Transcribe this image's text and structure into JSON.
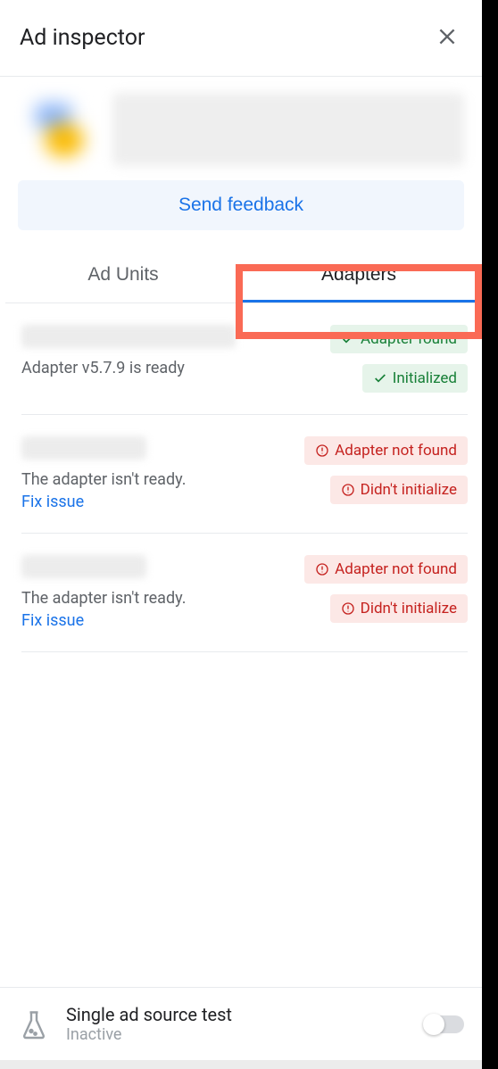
{
  "header": {
    "title": "Ad inspector"
  },
  "feedback_label": "Send feedback",
  "tabs": {
    "ad_units": "Ad Units",
    "adapters": "Adapters"
  },
  "adapters": [
    {
      "status_text": "Adapter v5.7.9 is ready",
      "fix_label": null,
      "badges": [
        {
          "type": "ok",
          "label": "Adapter found"
        },
        {
          "type": "ok",
          "label": "Initialized"
        }
      ]
    },
    {
      "status_text": "The adapter isn't ready.",
      "fix_label": "Fix issue",
      "badges": [
        {
          "type": "err",
          "label": "Adapter not found"
        },
        {
          "type": "err",
          "label": "Didn't initialize"
        }
      ]
    },
    {
      "status_text": "The adapter isn't ready.",
      "fix_label": "Fix issue",
      "badges": [
        {
          "type": "err",
          "label": "Adapter not found"
        },
        {
          "type": "err",
          "label": "Didn't initialize"
        }
      ]
    }
  ],
  "footer": {
    "title": "Single ad source test",
    "subtitle": "Inactive",
    "toggle_on": false
  },
  "highlight": {
    "target": "adapters-tab"
  }
}
